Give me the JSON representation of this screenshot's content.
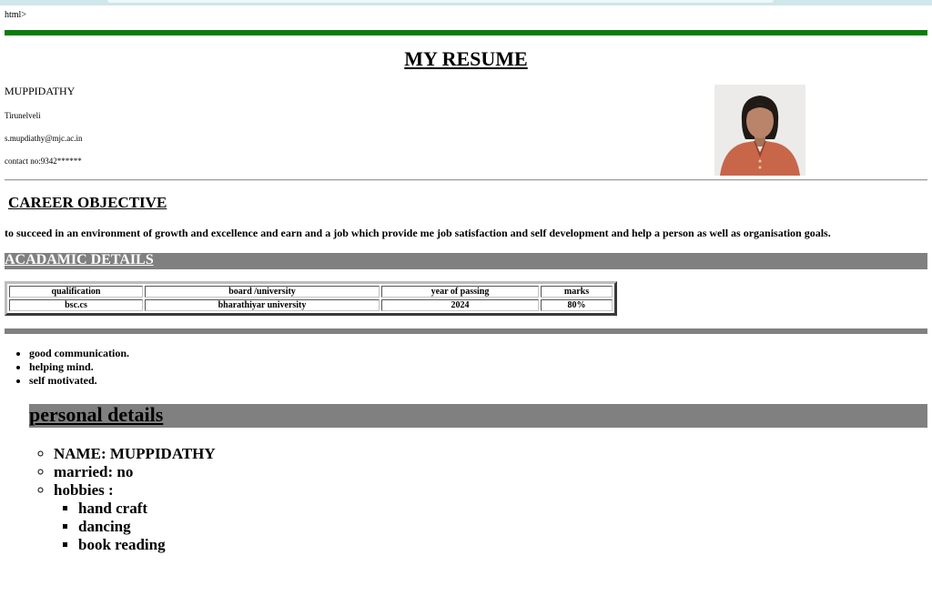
{
  "page": {
    "stray_text": "html>",
    "title": "MY RESUME"
  },
  "header": {
    "name": "MUPPIDATHY",
    "city": "Tirunelveli",
    "email": "s.mupdiathy@mjc.ac.in",
    "contact": "contact no:9342******"
  },
  "career": {
    "heading": "CAREER OBJECTIVE",
    "text": "to succeed in an environment of growth and excellence and earn and a job which provide me job satisfaction and self development and help a person as well as organisation goals."
  },
  "academic": {
    "heading": "ACADAMIC DETAILS",
    "headers": [
      "qualification",
      "board /university",
      "year of passing",
      "marks"
    ],
    "rows": [
      [
        "bsc.cs",
        "bharathiyar university",
        "2024",
        "80%"
      ]
    ]
  },
  "skills": [
    "good communication.",
    "helping mind.",
    "self motivated."
  ],
  "personal": {
    "heading": "personal details",
    "name": "NAME: MUPPIDATHY",
    "married": "married: no",
    "hobbies_label": "hobbies :",
    "hobbies": [
      "hand craft",
      "dancing",
      "book reading"
    ]
  },
  "colors": {
    "green_rule": "#0a7d0a",
    "grey_band": "#808080"
  }
}
